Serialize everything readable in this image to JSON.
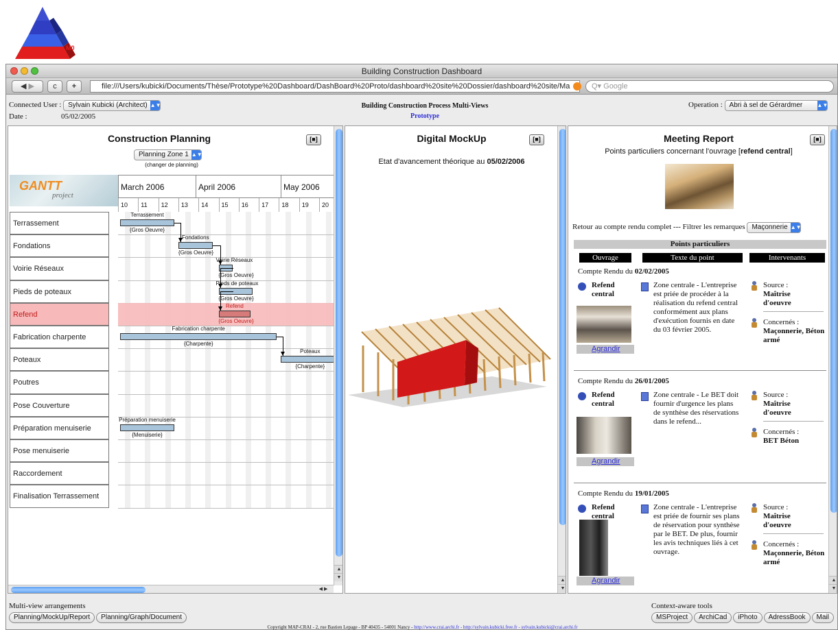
{
  "logo": {
    "label": "M0"
  },
  "window": {
    "title": "Building Construction Dashboard"
  },
  "browser": {
    "url": "file:///Users/kubicki/Documents/Thèse/Prototype%20Dashboard/DashBoard%20Proto/dashboard%20site%20Dossier/dashboard%20site/Ma",
    "search_placeholder": "Q▾ Google",
    "back_icon": "back-arrow-icon",
    "forward_icon": "forward-arrow-icon",
    "reload_icon": "reload-icon",
    "add_icon": "plus-icon"
  },
  "header": {
    "user_label": "Connected User :",
    "user_value": "Sylvain Kubicki (Architect)",
    "date_label": "Date :",
    "date_value": "05/02/2005",
    "center_title": "Building Construction Process Multi-Views",
    "center_link": "Prototype",
    "operation_label": "Operation :",
    "operation_value": "Abri à sel de Gérardmer"
  },
  "planning": {
    "title": "Construction Planning",
    "zone_select": "Planning Zone 1",
    "zone_hint": "(changer de planning)",
    "gantt_logo": "GANTT",
    "gantt_logo_sub": "project",
    "months": [
      "March 2006",
      "April 2006",
      "May 2006"
    ],
    "weeks": [
      "10",
      "11",
      "12",
      "13",
      "14",
      "15",
      "16",
      "17",
      "18",
      "19",
      "20"
    ],
    "rows": [
      "Terrassement",
      "Fondations",
      "Voirie Réseaux",
      "Pieds de poteaux",
      "Refend",
      "Fabrication charpente",
      "Poteaux",
      "Poutres",
      "Pose Couverture",
      "Préparation menuiserie",
      "Pose menuiserie",
      "Raccordement",
      "Finalisation Terrassement"
    ],
    "tasks": [
      {
        "name": "Terrassement",
        "group": "{Gros Oeuvre}"
      },
      {
        "name": "Fondations",
        "group": "{Gros Oeuvre}"
      },
      {
        "name": "Voirie Réseaux",
        "group": "{Gros Oeuvre}"
      },
      {
        "name": "Pieds de poteaux",
        "group": "{Gros Oeuvre}"
      },
      {
        "name": "Refend",
        "group": "{Gros Oeuvre}"
      },
      {
        "name": "Fabrication charpente",
        "group": "{Charpente}"
      },
      {
        "name": "Poteaux",
        "group": "{Charpente}"
      },
      {
        "name": "Préparation menuiserie",
        "group": "{Menuiserie}"
      }
    ],
    "highlight_color": "#f7b9b9"
  },
  "mockup": {
    "title": "Digital MockUp",
    "subtitle_prefix": "Etat d'avancement théorique au ",
    "subtitle_date": "05/02/2006"
  },
  "report": {
    "title": "Meeting Report",
    "subtitle_prefix": "Points particuliers concernant l'ouvrage [",
    "subtitle_bold": "refend central",
    "subtitle_suffix": "]",
    "filter_text": "Retour au compte rendu complet --- Filtrer les remarques",
    "filter_value": "Maçonnerie",
    "section_title": "Points particuliers",
    "col_headers": [
      "Ouvrage",
      "Texte du point",
      "Intervenants"
    ],
    "entries": [
      {
        "date_prefix": "Compte Rendu du ",
        "date": "02/02/2005",
        "ouvrage": "Refend central",
        "text": "Zone centrale - L'entreprise est priée de procéder à la réalisation du refend central conformément aux plans d'exécution fournis en date du 03 février 2005.",
        "source_label": "Source :",
        "source": "Maîtrise d'oeuvre",
        "concern_label": "Concernés :",
        "concerned": "Maçonnerie, Béton armé",
        "link": "Agrandir"
      },
      {
        "date_prefix": "Compte Rendu du ",
        "date": "26/01/2005",
        "ouvrage": "Refend central",
        "text": "Zone centrale - Le BET doit fournir d'urgence les plans de synthèse des réservations dans le refend...",
        "source_label": "Source :",
        "source": "Maîtrise d'oeuvre",
        "concern_label": "Concernés :",
        "concerned": "BET Béton",
        "link": "Agrandir"
      },
      {
        "date_prefix": "Compte Rendu du ",
        "date": "19/01/2005",
        "ouvrage": "Refend central",
        "text": "Zone centrale - L'entreprise est priée de fournir ses plans de réservation pour synthèse par le BET. De plus, fournir les avis techniques liés à cet ouvrage.",
        "source_label": "Source :",
        "source": "Maîtrise d'oeuvre",
        "concern_label": "Concernés :",
        "concerned": "Maçonnerie, Béton armé",
        "link": "Agrandir"
      }
    ]
  },
  "footer": {
    "left_title": "Multi-view arrangements",
    "left_buttons": [
      "Planning/MockUp/Report",
      "Planning/Graph/Document"
    ],
    "right_title": "Context-aware tools",
    "right_buttons": [
      "MSProject",
      "ArchiCad",
      "iPhoto",
      "AdressBook",
      "Mail"
    ],
    "copyright": "Copyright MAP-CRAI - 2, rue Bastien Lepage - BP 40435 - 54001 Nancy -",
    "links": "http://www.crai.archi.fr - http://sylvain.kubicki.free.fr - sylvain.kubicki@crai.archi.fr"
  }
}
